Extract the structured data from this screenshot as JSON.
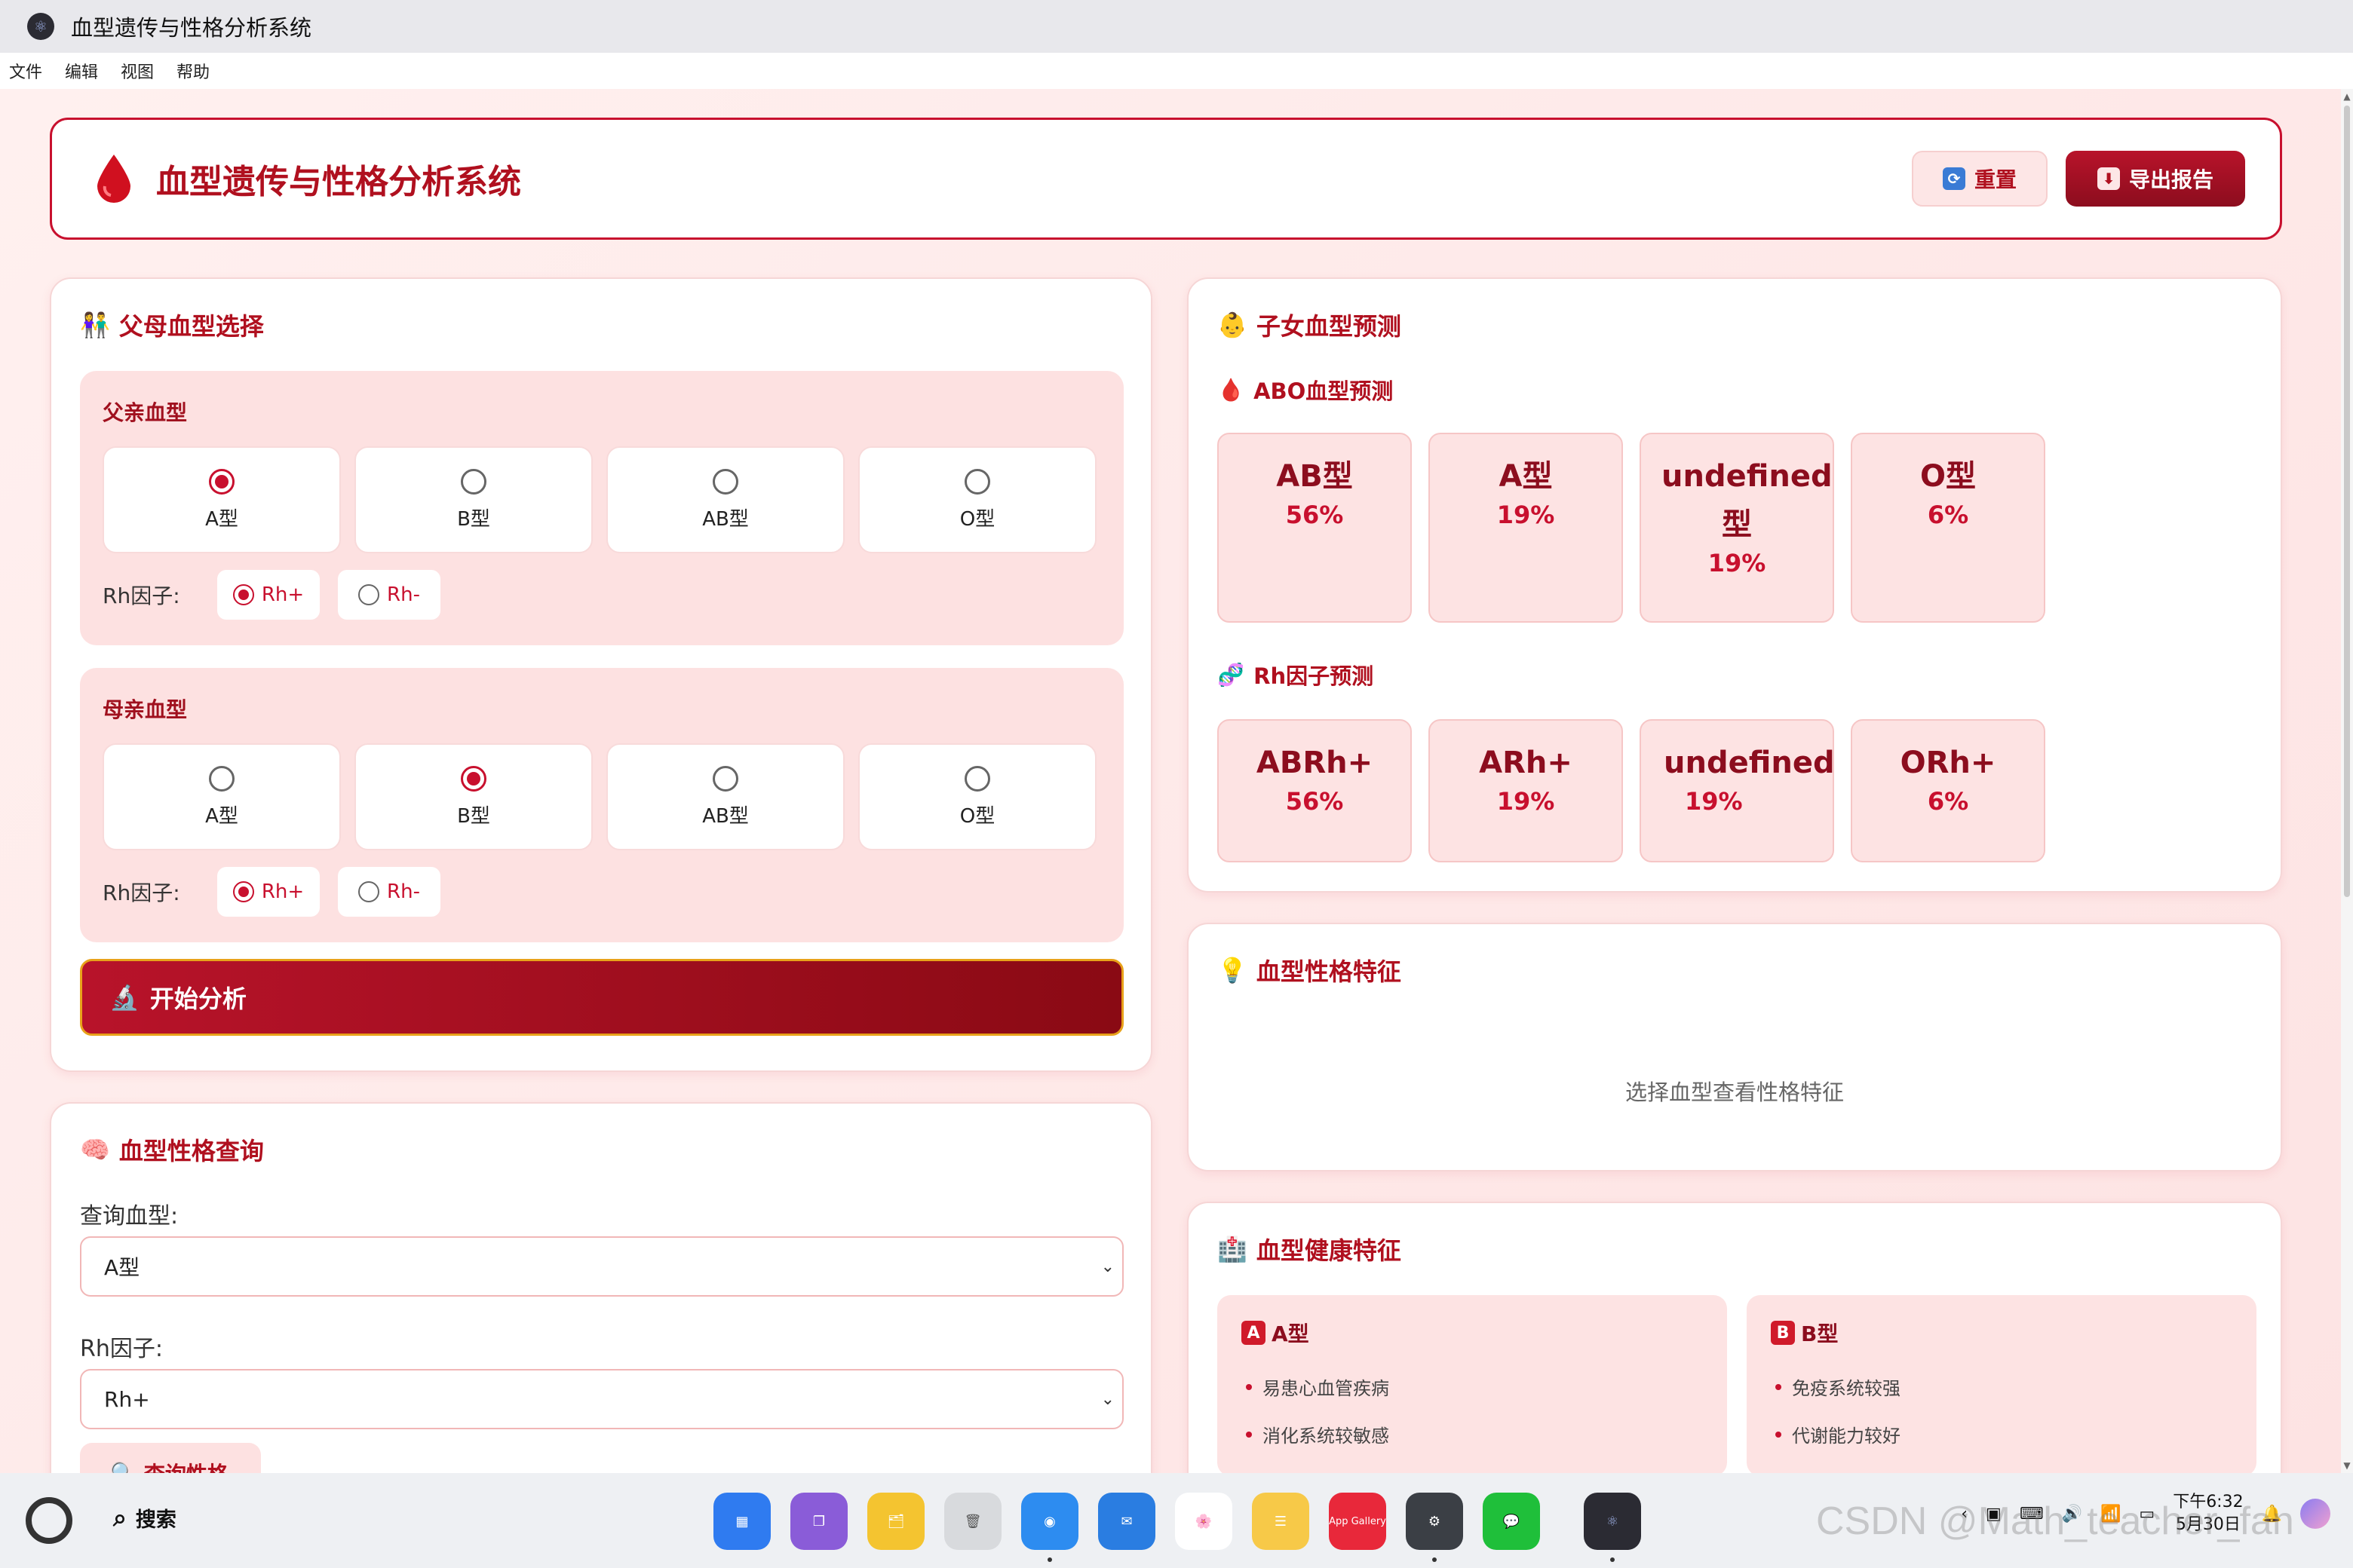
{
  "window": {
    "title": "血型遗传与性格分析系统"
  },
  "menu": [
    "文件",
    "编辑",
    "视图",
    "帮助"
  ],
  "header": {
    "title": "血型遗传与性格分析系统",
    "reset_label": "重置",
    "export_label": "导出报告"
  },
  "parents": {
    "title": "父母血型选择",
    "father": {
      "label": "父亲血型",
      "options": [
        "A型",
        "B型",
        "AB型",
        "O型"
      ],
      "selected": "A型",
      "rh_label": "Rh因子:",
      "rh_options": [
        "Rh+",
        "Rh-"
      ],
      "rh_selected": "Rh+"
    },
    "mother": {
      "label": "母亲血型",
      "options": [
        "A型",
        "B型",
        "AB型",
        "O型"
      ],
      "selected": "B型",
      "rh_label": "Rh因子:",
      "rh_options": [
        "Rh+",
        "Rh-"
      ],
      "rh_selected": "Rh+"
    },
    "analyze_label": "开始分析"
  },
  "query": {
    "title": "血型性格查询",
    "blood_label": "查询血型:",
    "blood_value": "A型",
    "rh_label": "Rh因子:",
    "rh_value": "Rh+",
    "button_label": "查询性格"
  },
  "prediction": {
    "title": "子女血型预测",
    "abo_title": "ABO血型预测",
    "abo": [
      {
        "type": "AB型",
        "pct": "56%"
      },
      {
        "type": "A型",
        "pct": "19%"
      },
      {
        "type": "undefined型",
        "pct": "19%"
      },
      {
        "type": "O型",
        "pct": "6%"
      }
    ],
    "rh_title": "Rh因子预测",
    "rh": [
      {
        "type": "ABRh+",
        "pct": "56%"
      },
      {
        "type": "ARh+",
        "pct": "19%"
      },
      {
        "type": "undefinedRh+",
        "pct": "19%"
      },
      {
        "type": "ORh+",
        "pct": "6%"
      }
    ]
  },
  "personality": {
    "title": "血型性格特征",
    "placeholder": "选择血型查看性格特征"
  },
  "health": {
    "title": "血型健康特征",
    "columns": [
      {
        "tag": "A",
        "name": "A型",
        "items": [
          "易患心血管疾病",
          "消化系统较敏感"
        ]
      },
      {
        "tag": "B",
        "name": "B型",
        "items": [
          "免疫系统较强",
          "代谢能力较好"
        ]
      }
    ]
  },
  "taskbar": {
    "search_label": "搜索",
    "appgallery_label": "App Gallery",
    "time": "下午6:32",
    "date": "5月30日"
  },
  "watermark": "CSDN @Math_teacher_fan",
  "colors": {
    "primary": "#c8102e",
    "dark_red": "#8c0d1e",
    "bg": "#fdecec"
  }
}
